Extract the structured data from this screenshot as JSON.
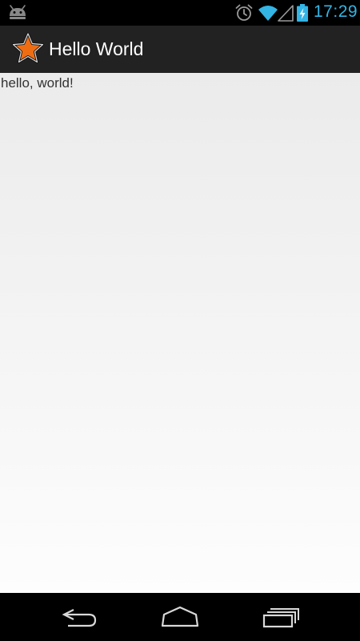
{
  "status_bar": {
    "time": "17:29",
    "icons": [
      "android-icon",
      "alarm-icon",
      "wifi-icon",
      "signal-icon",
      "battery-charging-icon"
    ],
    "accent_color": "#33b5e5"
  },
  "action_bar": {
    "title": "Hello World",
    "app_icon": "star-icon",
    "background": "#222222"
  },
  "content": {
    "message": "hello, world!"
  },
  "nav_bar": {
    "buttons": [
      "back-icon",
      "home-icon",
      "recent-apps-icon"
    ]
  }
}
